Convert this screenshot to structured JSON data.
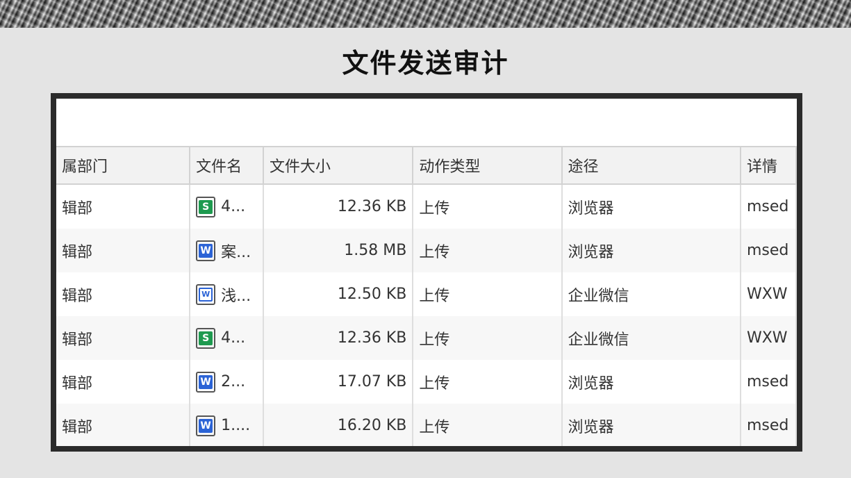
{
  "title": "文件发送审计",
  "table": {
    "headers": {
      "dept": "属部门",
      "filename": "文件名",
      "size": "文件大小",
      "action": "动作类型",
      "channel": "途径",
      "detail": "详情"
    },
    "rows": [
      {
        "dept": "辑部",
        "icon": "spreadsheet-icon",
        "icon_letter": "S",
        "filename": "4...",
        "size": "12.36 KB",
        "action": "上传",
        "channel": "浏览器",
        "detail": "msed"
      },
      {
        "dept": "辑部",
        "icon": "word-document-icon",
        "icon_letter": "W",
        "filename": "案...",
        "size": "1.58 MB",
        "action": "上传",
        "channel": "浏览器",
        "detail": "msed"
      },
      {
        "dept": "辑部",
        "icon": "word-document-outline-icon",
        "icon_letter": "W",
        "filename": "浅...",
        "size": "12.50 KB",
        "action": "上传",
        "channel": "企业微信",
        "detail": "WXW"
      },
      {
        "dept": "辑部",
        "icon": "spreadsheet-icon",
        "icon_letter": "S",
        "filename": "4...",
        "size": "12.36 KB",
        "action": "上传",
        "channel": "企业微信",
        "detail": "WXW"
      },
      {
        "dept": "辑部",
        "icon": "word-document-icon",
        "icon_letter": "W",
        "filename": "2...",
        "size": "17.07 KB",
        "action": "上传",
        "channel": "浏览器",
        "detail": "msed"
      },
      {
        "dept": "辑部",
        "icon": "word-document-icon",
        "icon_letter": "W",
        "filename": "1....",
        "size": "16.20 KB",
        "action": "上传",
        "channel": "浏览器",
        "detail": "msed"
      }
    ]
  },
  "colors": {
    "spreadsheet": "#1e9a4f",
    "word": "#2b63d6",
    "frame": "#2b2b2b",
    "background": "#e4e4e4"
  }
}
